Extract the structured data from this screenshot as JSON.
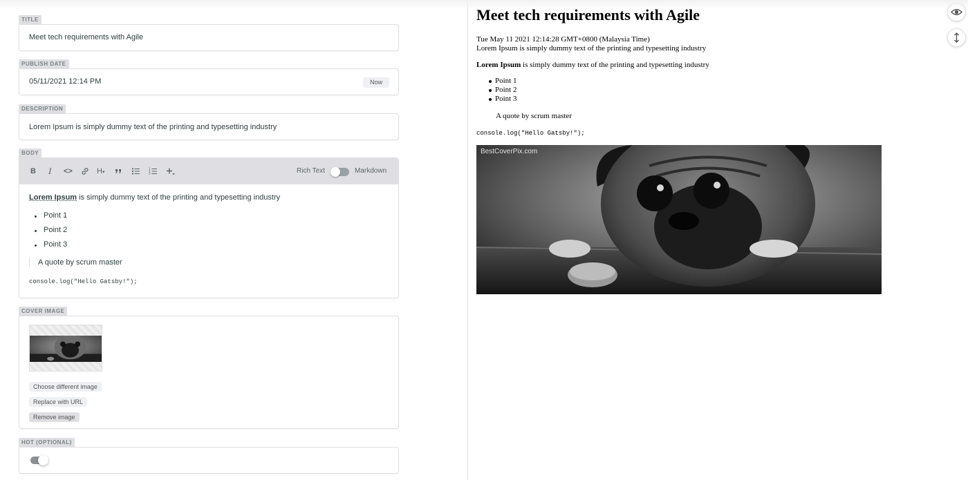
{
  "editor": {
    "title": {
      "label": "TITLE",
      "value": "Meet tech requirements with Agile"
    },
    "publish_date": {
      "label": "PUBLISH DATE",
      "value": "05/11/2021 12:14 PM",
      "now_button": "Now"
    },
    "description": {
      "label": "DESCRIPTION",
      "value": "Lorem Ipsum is simply dummy text of the printing and typesetting industry"
    },
    "body": {
      "label": "BODY",
      "toolbar": {
        "bold": "B",
        "italic": "I",
        "code": "<>",
        "heading": "H",
        "rich_text": "Rich Text",
        "markdown": "Markdown",
        "mode": "rich-text"
      },
      "content": {
        "para_bold": "Lorem Ipsum",
        "para_rest": " is simply dummy text of the printing and typesetting industry",
        "bullets": [
          "Point 1",
          "Point 2",
          "Point 3"
        ],
        "quote": "A quote by scrum master",
        "code": "console.log(\"Hello Gatsby!\");"
      }
    },
    "cover_image": {
      "label": "COVER IMAGE",
      "choose_button": "Choose different image",
      "replace_button": "Replace with URL",
      "remove_button": "Remove image"
    },
    "hot": {
      "label": "HOT (OPTIONAL)",
      "value": false
    }
  },
  "preview": {
    "title": "Meet tech requirements with Agile",
    "date": "Tue May 11 2021 12:14:28 GMT+0800 (Malaysia Time)",
    "description": "Lorem Ipsum is simply dummy text of the printing and typesetting industry",
    "para_bold": "Lorem Ipsum",
    "para_rest": " is simply dummy text of the printing and typesetting industry",
    "bullets": [
      "Point 1",
      "Point 2",
      "Point 3"
    ],
    "quote": "A quote by scrum master",
    "code": "console.log(\"Hello Gatsby!\");",
    "image_watermark": "BestCoverPix.com"
  },
  "side_buttons": {
    "preview_icon": "eye-icon",
    "scroll_sync_icon": "scroll-sync-icon"
  }
}
